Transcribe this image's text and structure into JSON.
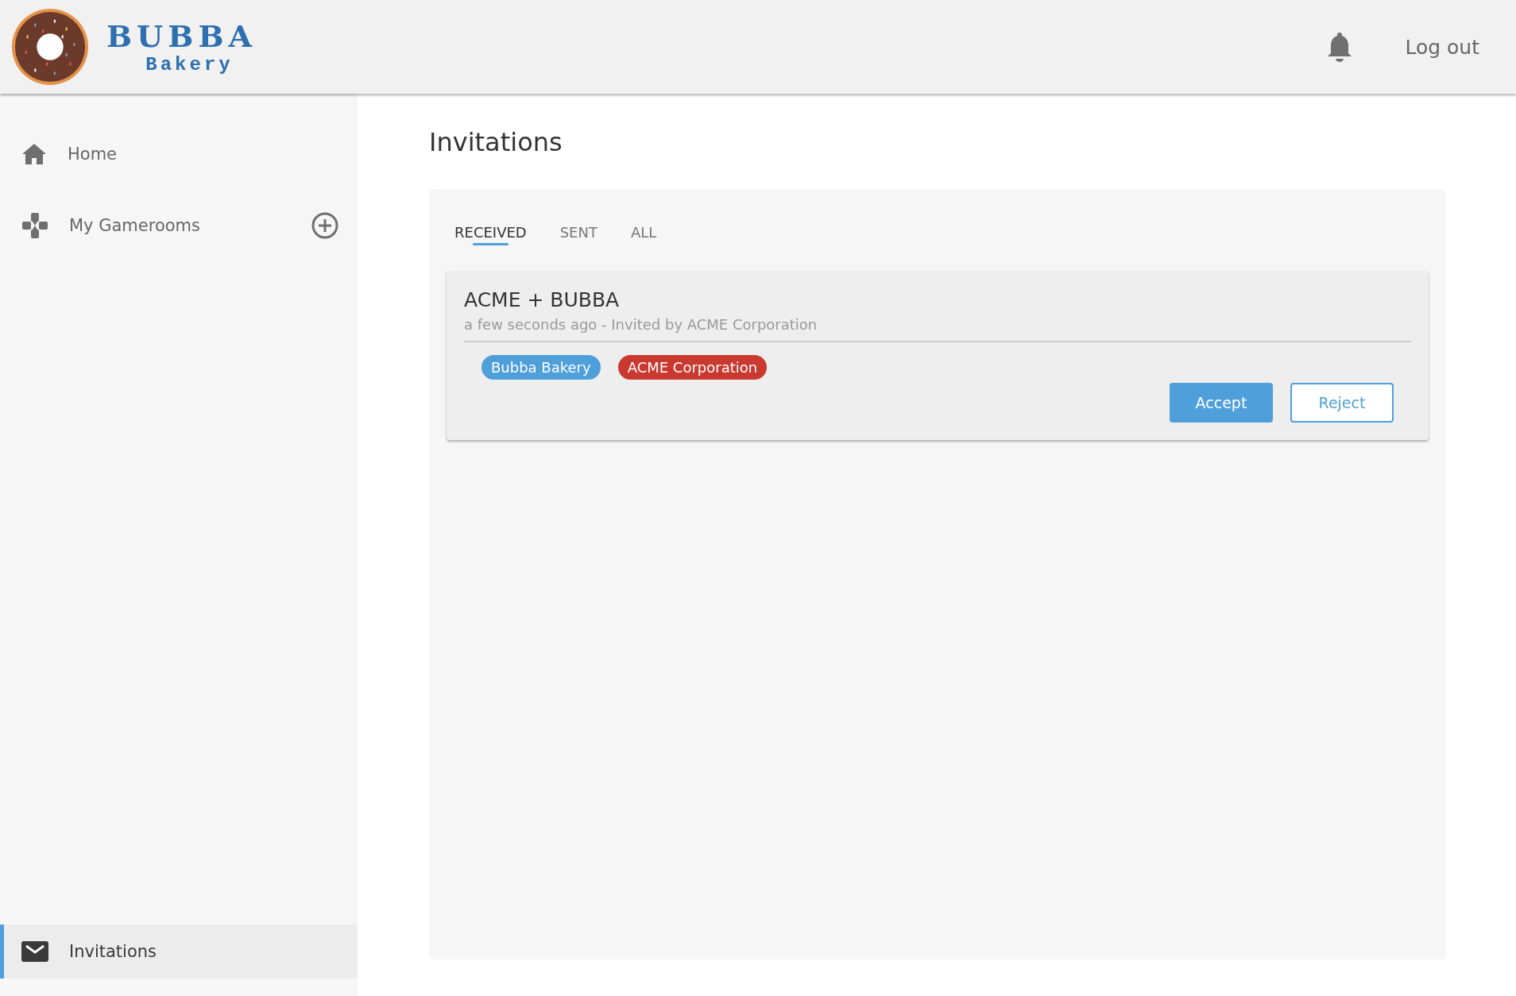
{
  "header": {
    "logo": {
      "title": "BUBBA",
      "subtitle": "Bakery"
    },
    "logout": "Log out"
  },
  "sidebar": {
    "items": [
      {
        "label": "Home",
        "kind": "home",
        "selected": false
      },
      {
        "label": "My Gamerooms",
        "kind": "gamerooms",
        "selected": false
      },
      {
        "label": "Invitations",
        "kind": "invitations",
        "selected": true
      }
    ]
  },
  "page": {
    "title": "Invitations",
    "tabs": [
      {
        "label": "RECEIVED",
        "selected": true
      },
      {
        "label": "SENT",
        "selected": false
      },
      {
        "label": "ALL",
        "selected": false
      }
    ],
    "invitations": [
      {
        "title": "ACME + BUBBA",
        "meta": "a few seconds ago - Invited by ACME Corporation",
        "members": [
          {
            "name": "Bubba Bakery",
            "color": "#4f9fdb"
          },
          {
            "name": "ACME Corporation",
            "color": "#c9392f"
          }
        ],
        "actions": [
          {
            "label": "Accept",
            "kind": "primary"
          },
          {
            "label": "Reject",
            "kind": "secondary"
          }
        ]
      }
    ]
  }
}
